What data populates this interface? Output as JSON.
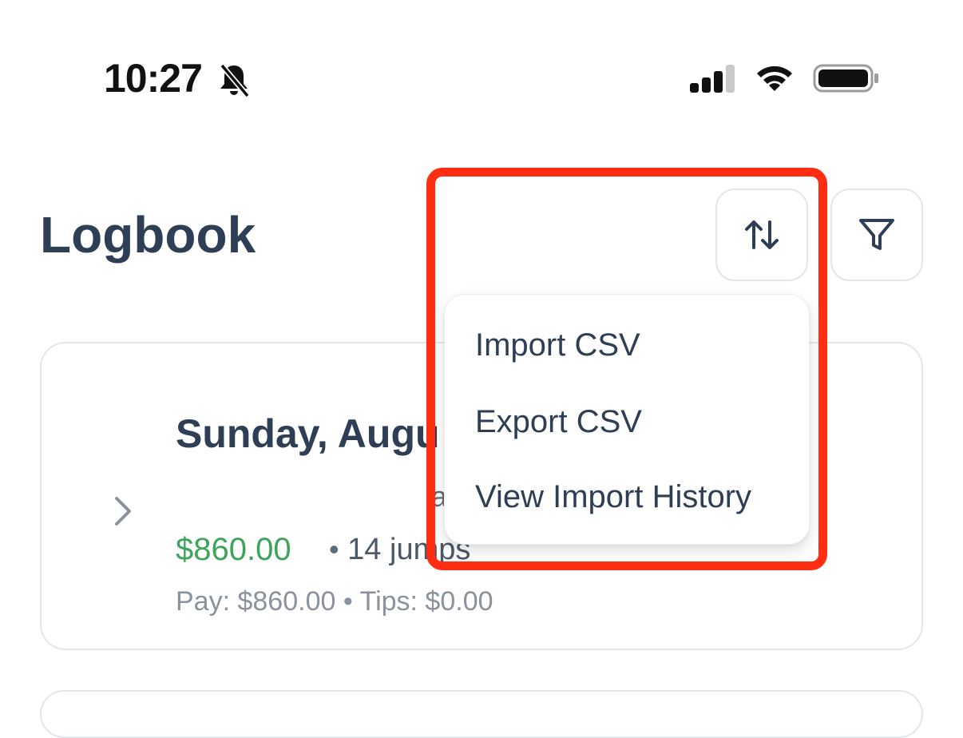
{
  "status_bar": {
    "time": "10:27",
    "bell_icon": "bell-slash-icon",
    "signal_icon": "cellular-signal-icon",
    "wifi_icon": "wifi-icon",
    "battery_icon": "battery-icon"
  },
  "header": {
    "title": "Logbook",
    "sort_icon": "sort-arrows-icon",
    "filter_icon": "filter-funnel-icon"
  },
  "entry": {
    "date": "Sunday, Augu",
    "subtext": "a",
    "amount": "$860.00",
    "separator": "•",
    "jumps": "14 jumps",
    "pay_tips": "Pay: $860.00 • Tips: $0.00",
    "chevron_icon": "chevron-right-icon"
  },
  "menu": {
    "items": [
      {
        "label": "Import CSV"
      },
      {
        "label": "Export CSV"
      },
      {
        "label": "View Import History"
      }
    ]
  },
  "colors": {
    "title": "#2d3e55",
    "amount_green": "#3fa45b",
    "highlight_red": "#ff2d12",
    "border": "#e3e6ea"
  }
}
